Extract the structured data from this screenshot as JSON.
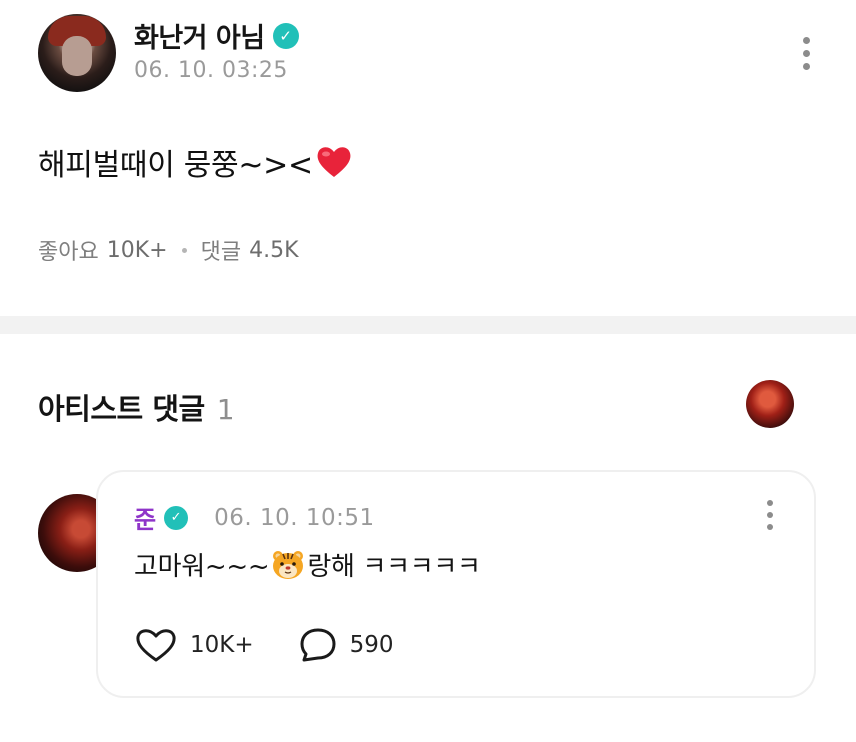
{
  "post": {
    "author": "화난거 아님",
    "time": "06. 10. 03:25",
    "body_text": "해피벌때이 뭉쭝~><",
    "likes_label": "좋아요",
    "likes_count": "10K+",
    "comments_label": "댓글",
    "comments_count": "4.5K"
  },
  "artist_comments": {
    "title": "아티스트 댓글",
    "count": "1"
  },
  "comment": {
    "author": "준",
    "time": "06. 10. 10:51",
    "text_before": "고마워~~~",
    "text_after": "랑해 ㅋㅋㅋㅋㅋ",
    "likes": "10K+",
    "replies": "590"
  },
  "colors": {
    "verified": "#21c0b8",
    "artist_name": "#8f35c9",
    "muted_text": "#9a9a9a",
    "divider": "#f2f2f2"
  },
  "icons": {
    "verified": "verified-badge-icon",
    "menu": "more-vertical-icon",
    "like": "heart-outline-icon",
    "reply": "speech-bubble-icon",
    "post_emoji": "red-heart-emoji",
    "comment_emoji": "tiger-face-emoji"
  }
}
